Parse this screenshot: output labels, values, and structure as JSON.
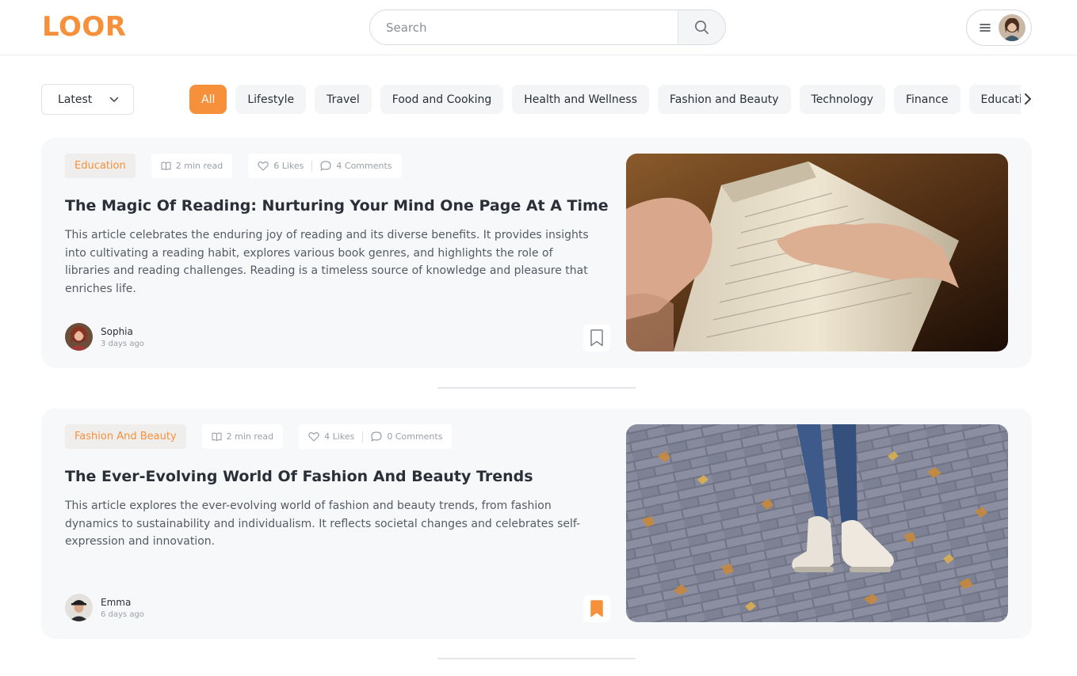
{
  "header": {
    "logo": "LOOR",
    "search_placeholder": "Search",
    "icons": {
      "search": "search-icon",
      "menu": "hamburger-menu-icon",
      "avatar": "user-avatar"
    }
  },
  "filters": {
    "sort_label": "Latest",
    "categories": [
      {
        "label": "All",
        "active": true
      },
      {
        "label": "Lifestyle"
      },
      {
        "label": "Travel"
      },
      {
        "label": "Food and Cooking"
      },
      {
        "label": "Health and Wellness"
      },
      {
        "label": "Fashion and Beauty"
      },
      {
        "label": "Technology"
      },
      {
        "label": "Finance"
      },
      {
        "label": "Education"
      }
    ]
  },
  "posts": [
    {
      "category": "Education",
      "read_time": "2 min read",
      "likes": "6 Likes",
      "comments": "4 Comments",
      "title": "The Magic Of Reading: Nurturing Your Mind One Page At A Time",
      "description": "This article celebrates the enduring joy of reading and its diverse benefits. It provides insights into cultivating a reading habit, explores various book genres, and highlights the role of libraries and reading challenges. Reading is a timeless source of knowledge and pleasure that enriches life.",
      "author": "Sophia",
      "time": "3 days ago",
      "bookmarked": false
    },
    {
      "category": "Fashion And Beauty",
      "read_time": "2 min read",
      "likes": "4 Likes",
      "comments": "0 Comments",
      "title": "The Ever-Evolving World Of Fashion And Beauty Trends",
      "description": "This article explores the ever-evolving world of fashion and beauty trends, from fashion dynamics to sustainability and individualism. It reflects societal changes and celebrates self-expression and innovation.",
      "author": "Emma",
      "time": "6 days ago",
      "bookmarked": true
    }
  ],
  "colors": {
    "accent": "#f7903a",
    "card_bg": "#f7f8fa",
    "text": "#2b2f38",
    "muted": "#9aa0a8"
  }
}
